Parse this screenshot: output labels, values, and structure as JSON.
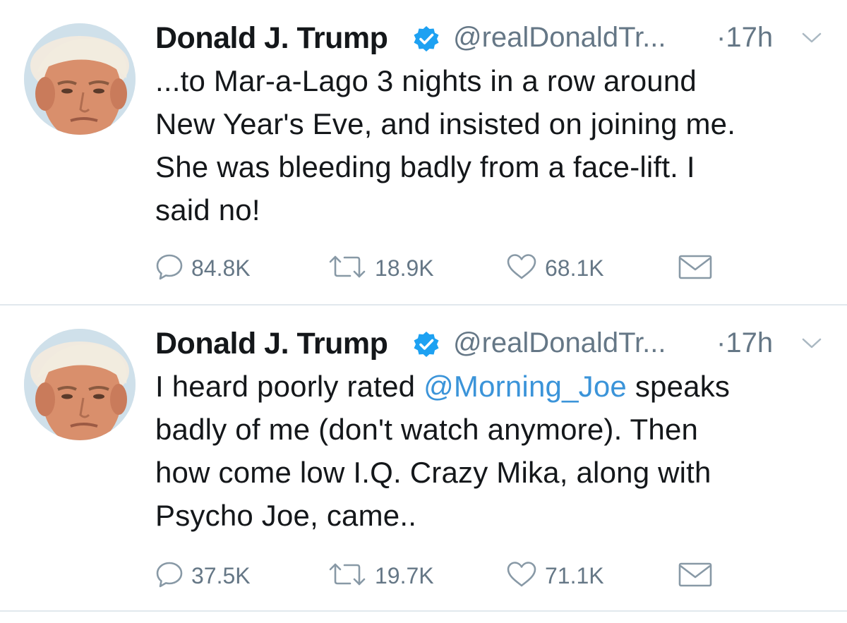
{
  "tweets": [
    {
      "author_name": "Donald J. Trump",
      "verified": true,
      "handle": "@realDonaldTr...",
      "time": "·17h",
      "text_lines": [
        [
          {
            "t": "...to Mar-a-Lago 3 nights in a row around"
          }
        ],
        [
          {
            "t": "New Year's Eve, and insisted on joining me."
          }
        ],
        [
          {
            "t": "She was bleeding badly from a face-lift. I"
          }
        ],
        [
          {
            "t": "said no!"
          }
        ]
      ],
      "replies": "84.8K",
      "retweets": "18.9K",
      "likes": "68.1K"
    },
    {
      "author_name": "Donald J. Trump",
      "verified": true,
      "handle": "@realDonaldTr...",
      "time": "·17h",
      "line1_before": "I heard poorly rated ",
      "mention": "@Morning_Joe",
      "line1_after": " speaks",
      "line2": "badly of me (don't watch anymore). Then",
      "line3": "how come low I.Q. Crazy Mika, along with",
      "line4": "Psycho Joe, came..",
      "replies": "37.5K",
      "retweets": "19.7K",
      "likes": "71.1K"
    }
  ],
  "icons": {
    "reply": "speech-bubble-icon",
    "retweet": "retweet-arrows-icon",
    "like": "heart-icon",
    "dm": "envelope-icon",
    "verified": "verified-badge-icon",
    "menu": "chevron-down-icon"
  },
  "colors": {
    "text": "#14171a",
    "secondary": "#657786",
    "link": "#3b94d9",
    "verified": "#1da1f2",
    "divider": "#e1e8ed"
  }
}
